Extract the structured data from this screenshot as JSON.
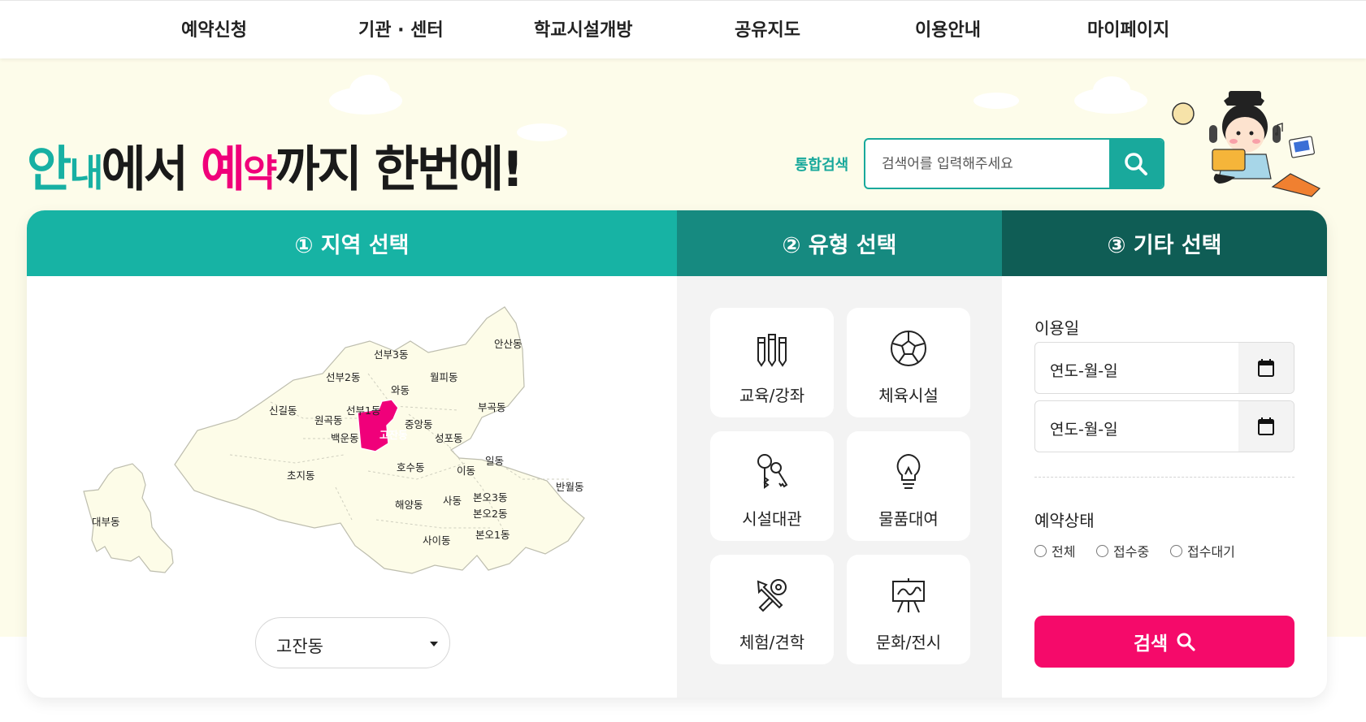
{
  "nav": {
    "items": [
      "예약신청",
      "기관 · 센터",
      "학교시설개방",
      "공유지도",
      "이용안내",
      "마이페이지"
    ]
  },
  "hero": {
    "slogan": {
      "p1": "안",
      "p2": "내",
      "p3": "에서 ",
      "p4": "예",
      "p5": "약",
      "p6": "까지 한번에!"
    },
    "search": {
      "label": "통합검색",
      "placeholder": "검색어를 입력해주세요",
      "button_icon": "search-icon"
    }
  },
  "tabs": [
    "① 지역 선택",
    "② 유형 선택",
    "③ 기타 선택"
  ],
  "map": {
    "dongs": [
      "대부동",
      "선부3동",
      "선부2동",
      "와동",
      "월피동",
      "안산동",
      "신길동",
      "원곡동",
      "선부1동",
      "중앙동",
      "부곡동",
      "백운동",
      "고잔동",
      "성포동",
      "초지동",
      "호수동",
      "이동",
      "일동",
      "반월동",
      "해양동",
      "사동",
      "본오3동",
      "본오2동",
      "사이동",
      "본오1동"
    ],
    "selected": "고잔동",
    "highlight_color": "#f0007a"
  },
  "region_select": {
    "value": "고잔동"
  },
  "types": [
    {
      "label": "교육/강좌",
      "icon": "pencils-icon"
    },
    {
      "label": "체육시설",
      "icon": "soccer-ball-icon"
    },
    {
      "label": "시설대관",
      "icon": "keys-icon"
    },
    {
      "label": "물품대여",
      "icon": "lightbulb-icon"
    },
    {
      "label": "체험/견학",
      "icon": "tools-icon"
    },
    {
      "label": "문화/전시",
      "icon": "easel-icon"
    }
  ],
  "etc": {
    "date_label": "이용일",
    "date_from": "연도-월-일",
    "date_to": "연도-월-일",
    "status_label": "예약상태",
    "status_options": [
      "전체",
      "접수중",
      "접수대기"
    ],
    "submit_label": "검색"
  },
  "colors": {
    "teal": "#17b3a4",
    "teal_mid": "#168a80",
    "teal_dark": "#0f5d55",
    "pink": "#f50a6a",
    "hero_bg": "#fdfcea"
  }
}
